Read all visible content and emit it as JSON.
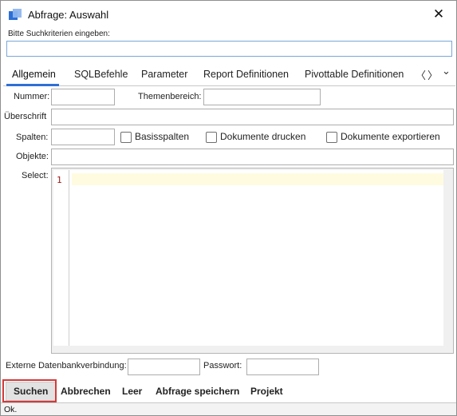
{
  "window": {
    "title": "Abfrage:  Auswahl"
  },
  "criteria": {
    "label": "Bitte Suchkriterien eingeben:",
    "value": ""
  },
  "tabs": [
    {
      "label": "Allgemein",
      "active": true
    },
    {
      "label": "SQLBefehle",
      "active": false
    },
    {
      "label": "Parameter",
      "active": false
    },
    {
      "label": "Report Definitionen",
      "active": false
    },
    {
      "label": "Pivottable Definitionen",
      "active": false
    }
  ],
  "tab_nav": {
    "prev": "〈",
    "next": "〉",
    "menu": "⌄"
  },
  "form": {
    "nummer_label": "Nummer:",
    "nummer_value": "",
    "themenbereich_label": "Themenbereich:",
    "themenbereich_value": "",
    "ueberschrift_label": "Überschrift",
    "ueberschrift_value": "",
    "spalten_label": "Spalten:",
    "spalten_value": "",
    "basisspalten_label": "Basisspalten",
    "basisspalten_checked": false,
    "dokumente_drucken_label": "Dokumente drucken",
    "dokumente_drucken_checked": false,
    "dokumente_exportieren_label": "Dokumente exportieren",
    "dokumente_exportieren_checked": false,
    "objekte_label": "Objekte:",
    "objekte_value": "",
    "select_label": "Select:",
    "select_line_number": "1",
    "select_code": ""
  },
  "external": {
    "db_label": "Externe Datenbankverbindung:",
    "db_value": "",
    "password_label": "Passwort:",
    "password_value": ""
  },
  "buttons": {
    "suchen": "Suchen",
    "abbrechen": "Abbrechen",
    "leer": "Leer",
    "abfrage_speichern": "Abfrage speichern",
    "projekt": "Projekt"
  },
  "status": {
    "text": "Ok."
  },
  "icons": {
    "app": "app-window-icon",
    "close": "close-icon"
  },
  "colors": {
    "accent": "#2e6fd6",
    "highlight": "#d43a3a",
    "current_line": "#fffbe0",
    "line_number": "#a31515"
  }
}
